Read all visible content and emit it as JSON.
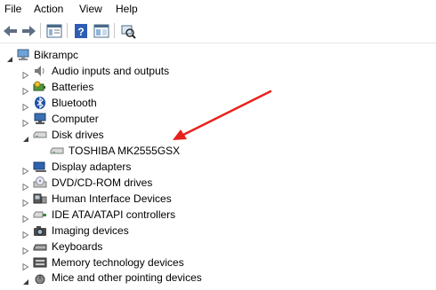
{
  "menubar": {
    "items": [
      "File",
      "Action",
      "View",
      "Help"
    ]
  },
  "tree": {
    "root": {
      "label": "Bikrampc",
      "expanded": true
    },
    "categories": [
      {
        "label": "Audio inputs and outputs",
        "icon": "speaker-icon",
        "expanded": false
      },
      {
        "label": "Batteries",
        "icon": "battery-icon",
        "expanded": false
      },
      {
        "label": "Bluetooth",
        "icon": "bluetooth-icon",
        "expanded": false
      },
      {
        "label": "Computer",
        "icon": "computer-icon",
        "expanded": false
      },
      {
        "label": "Disk drives",
        "icon": "disk-drive-icon",
        "expanded": true,
        "children": [
          {
            "label": "TOSHIBA MK2555GSX",
            "icon": "disk-drive-icon"
          }
        ]
      },
      {
        "label": "Display adapters",
        "icon": "display-adapter-icon",
        "expanded": false
      },
      {
        "label": "DVD/CD-ROM drives",
        "icon": "dvd-drive-icon",
        "expanded": false
      },
      {
        "label": "Human Interface Devices",
        "icon": "hid-icon",
        "expanded": false
      },
      {
        "label": "IDE ATA/ATAPI controllers",
        "icon": "ide-controller-icon",
        "expanded": false
      },
      {
        "label": "Imaging devices",
        "icon": "camera-icon",
        "expanded": false
      },
      {
        "label": "Keyboards",
        "icon": "keyboard-icon",
        "expanded": false
      },
      {
        "label": "Memory technology devices",
        "icon": "memory-icon",
        "expanded": false
      },
      {
        "label": "Mice and other pointing devices",
        "icon": "mouse-icon",
        "expanded": true
      }
    ]
  },
  "colors": {
    "annotation_arrow": "#e8221b",
    "expander": "#7a7a7a",
    "toolbar_separator": "#c8c8c8"
  }
}
